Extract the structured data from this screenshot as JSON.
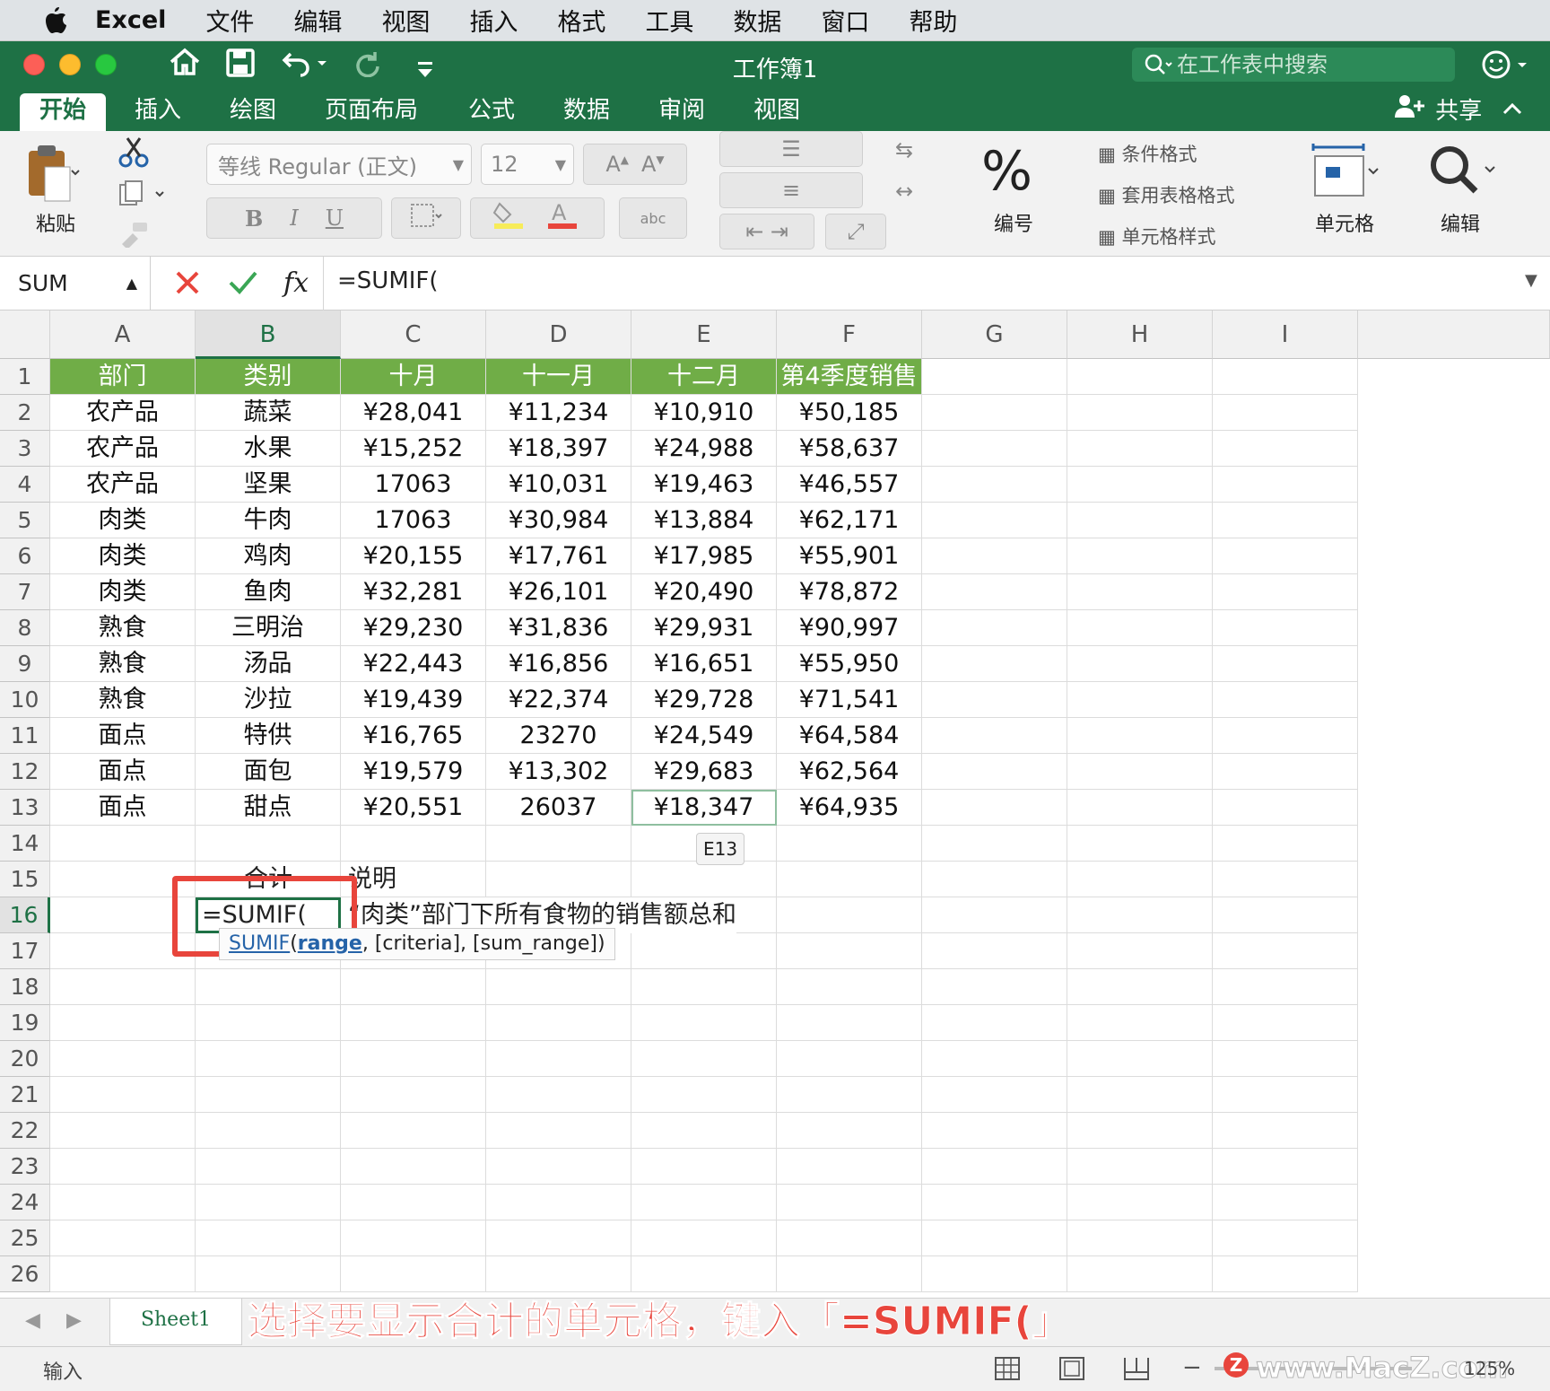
{
  "menubar": {
    "app": "Excel",
    "items": [
      "文件",
      "编辑",
      "视图",
      "插入",
      "格式",
      "工具",
      "数据",
      "窗口",
      "帮助"
    ]
  },
  "window": {
    "title": "工作簿1",
    "search_placeholder": "在工作表中搜索",
    "share_label": "共享"
  },
  "ribbon_tabs": [
    "开始",
    "插入",
    "绘图",
    "页面布局",
    "公式",
    "数据",
    "审阅",
    "视图"
  ],
  "ribbon": {
    "paste_label": "粘贴",
    "font_name": "等线 Regular (正文)",
    "font_size": "12",
    "bold": "B",
    "italic": "I",
    "underline": "U",
    "number_label": "编号",
    "conditional_format": "条件格式",
    "table_format": "套用表格格式",
    "cell_style": "单元格样式",
    "cells_label": "单元格",
    "edit_label": "编辑"
  },
  "formula_bar": {
    "name_box": "SUM",
    "fx": "fx",
    "formula": "=SUMIF("
  },
  "columns": [
    "A",
    "B",
    "C",
    "D",
    "E",
    "F",
    "G",
    "H",
    "I"
  ],
  "rows": [
    "1",
    "2",
    "3",
    "4",
    "5",
    "6",
    "7",
    "8",
    "9",
    "10",
    "11",
    "12",
    "13",
    "14",
    "15",
    "16",
    "17",
    "18",
    "19",
    "20",
    "21",
    "22",
    "23",
    "24",
    "25",
    "26"
  ],
  "table": {
    "header": [
      "部门",
      "类别",
      "十月",
      "十一月",
      "十二月",
      "第4季度销售"
    ],
    "data": [
      [
        "农产品",
        "蔬菜",
        "¥28,041",
        "¥11,234",
        "¥10,910",
        "¥50,185"
      ],
      [
        "农产品",
        "水果",
        "¥15,252",
        "¥18,397",
        "¥24,988",
        "¥58,637"
      ],
      [
        "农产品",
        "坚果",
        "17063",
        "¥10,031",
        "¥19,463",
        "¥46,557"
      ],
      [
        "肉类",
        "牛肉",
        "17063",
        "¥30,984",
        "¥13,884",
        "¥62,171"
      ],
      [
        "肉类",
        "鸡肉",
        "¥20,155",
        "¥17,761",
        "¥17,985",
        "¥55,901"
      ],
      [
        "肉类",
        "鱼肉",
        "¥32,281",
        "¥26,101",
        "¥20,490",
        "¥78,872"
      ],
      [
        "熟食",
        "三明治",
        "¥29,230",
        "¥31,836",
        "¥29,931",
        "¥90,997"
      ],
      [
        "熟食",
        "汤品",
        "¥22,443",
        "¥16,856",
        "¥16,651",
        "¥55,950"
      ],
      [
        "熟食",
        "沙拉",
        "¥19,439",
        "¥22,374",
        "¥29,728",
        "¥71,541"
      ],
      [
        "面点",
        "特供",
        "¥16,765",
        "23270",
        "¥24,549",
        "¥64,584"
      ],
      [
        "面点",
        "面包",
        "¥19,579",
        "¥13,302",
        "¥29,683",
        "¥62,564"
      ],
      [
        "面点",
        "甜点",
        "¥20,551",
        "26037",
        "¥18,347",
        "¥64,935"
      ]
    ]
  },
  "row15": {
    "b": "合计",
    "c": "说明"
  },
  "row16": {
    "b": "=SUMIF(",
    "c": "“肉类”部门下所有食物的销售额总和"
  },
  "tooltip_cell": "E13",
  "func_hint": {
    "name": "SUMIF",
    "arg1": "range",
    "rest": ", [criteria], [sum_range])"
  },
  "sheet_tab": "Sheet1",
  "caption": "选择要显示合计的单元格，键入「=SUMIF(」",
  "status": {
    "mode": "输入",
    "watermark": "www.MacZ.com",
    "zoom": "125%"
  },
  "colors": {
    "excel_green": "#1e7145",
    "header_green": "#70ad47",
    "highlight_red": "#e8453c"
  }
}
